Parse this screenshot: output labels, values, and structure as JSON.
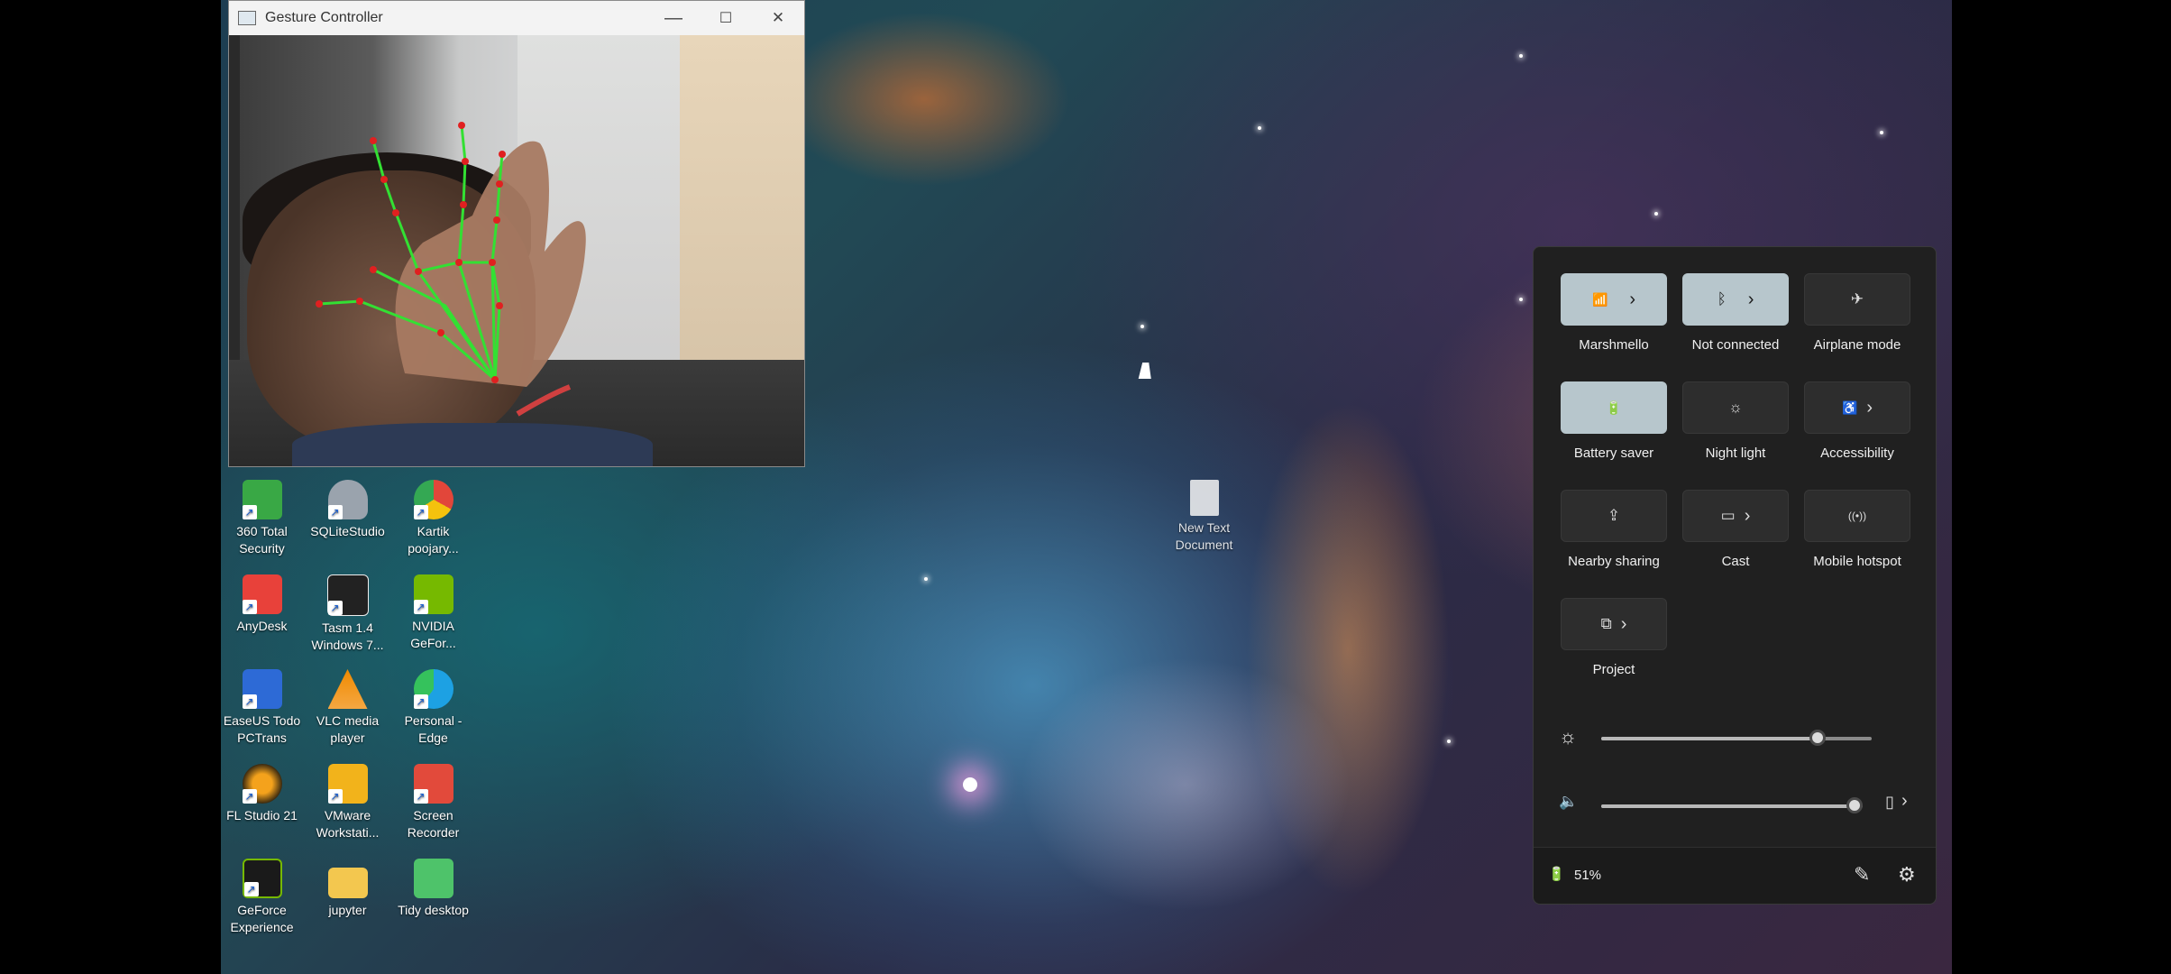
{
  "gesture_window": {
    "title": "Gesture Controller",
    "minimize_glyph": "—",
    "maximize_glyph": "☐",
    "close_glyph": "✕"
  },
  "desktop_icons": [
    {
      "label": "360 Total Security",
      "icon": "shield-plus-icon",
      "color": "#39a845"
    },
    {
      "label": "SQLiteStudio",
      "icon": "database-icon",
      "color": "#9aa3ad"
    },
    {
      "label": "Kartik poojary...",
      "icon": "chrome-icon",
      "color": "#e2463a"
    },
    {
      "label": "AnyDesk",
      "icon": "anydesk-icon",
      "color": "#e8413a"
    },
    {
      "label": "Tasm 1.4 Windows 7...",
      "icon": "apple-icon",
      "color": "#ffffff"
    },
    {
      "label": "NVIDIA GeFor...",
      "icon": "nvidia-icon",
      "color": "#76b900"
    },
    {
      "label": "EaseUS Todo PCTrans",
      "icon": "easeus-icon",
      "color": "#2d6ad6"
    },
    {
      "label": "VLC media player",
      "icon": "vlc-cone-icon",
      "color": "#f08a00"
    },
    {
      "label": "Personal - Edge",
      "icon": "edge-icon",
      "color": "#1da1e3"
    },
    {
      "label": "FL Studio 21",
      "icon": "fl-studio-icon",
      "color": "#f4a21c"
    },
    {
      "label": "VMware Workstati...",
      "icon": "vmware-icon",
      "color": "#f2b31b"
    },
    {
      "label": "Screen Recorder",
      "icon": "screen-recorder-icon",
      "color": "#e24a3b"
    },
    {
      "label": "GeForce Experience",
      "icon": "geforce-icon",
      "color": "#76b900"
    },
    {
      "label": "jupyter",
      "icon": "folder-icon",
      "color": "#f3c74f"
    },
    {
      "label": "Tidy desktop",
      "icon": "tidy-desktop-icon",
      "color": "#4ec36a"
    }
  ],
  "desktop_file": {
    "label": "New Text Document",
    "icon": "text-file-icon"
  },
  "quick_settings": {
    "tiles": [
      {
        "label": "Marshmello",
        "icon": "wifi-icon",
        "glyph": "📶",
        "active": true,
        "has_arrow": true
      },
      {
        "label": "Not connected",
        "icon": "bluetooth-icon",
        "glyph": "ᛒ",
        "active": true,
        "has_arrow": true
      },
      {
        "label": "Airplane mode",
        "icon": "airplane-icon",
        "glyph": "✈",
        "active": false,
        "has_arrow": false
      },
      {
        "label": "Battery saver",
        "icon": "battery-saver-icon",
        "glyph": "🔋",
        "active": true,
        "has_arrow": false
      },
      {
        "label": "Night light",
        "icon": "night-light-icon",
        "glyph": "☼",
        "active": false,
        "has_arrow": false
      },
      {
        "label": "Accessibility",
        "icon": "accessibility-icon",
        "glyph": "♿",
        "active": false,
        "has_arrow": true
      },
      {
        "label": "Nearby sharing",
        "icon": "nearby-sharing-icon",
        "glyph": "⇪",
        "active": false,
        "has_arrow": false
      },
      {
        "label": "Cast",
        "icon": "cast-icon",
        "glyph": "▭",
        "active": false,
        "has_arrow": true
      },
      {
        "label": "Mobile hotspot",
        "icon": "hotspot-icon",
        "glyph": "((•))",
        "active": false,
        "has_arrow": false
      },
      {
        "label": "Project",
        "icon": "project-icon",
        "glyph": "⧉",
        "active": false,
        "has_arrow": true
      }
    ],
    "arrow_glyph": "›",
    "brightness": {
      "icon": "brightness-icon",
      "glyph": "☼",
      "level": 0.8
    },
    "volume": {
      "icon": "speaker-icon",
      "glyph": "🔈",
      "level": 0.97,
      "device_icon": "audio-device-icon",
      "device_glyph": "▯",
      "arrow": "›"
    },
    "battery": {
      "icon": "battery-icon",
      "glyph": "🔋",
      "percent": "51%"
    },
    "edit_glyph": "✎",
    "settings_glyph": "⚙"
  }
}
